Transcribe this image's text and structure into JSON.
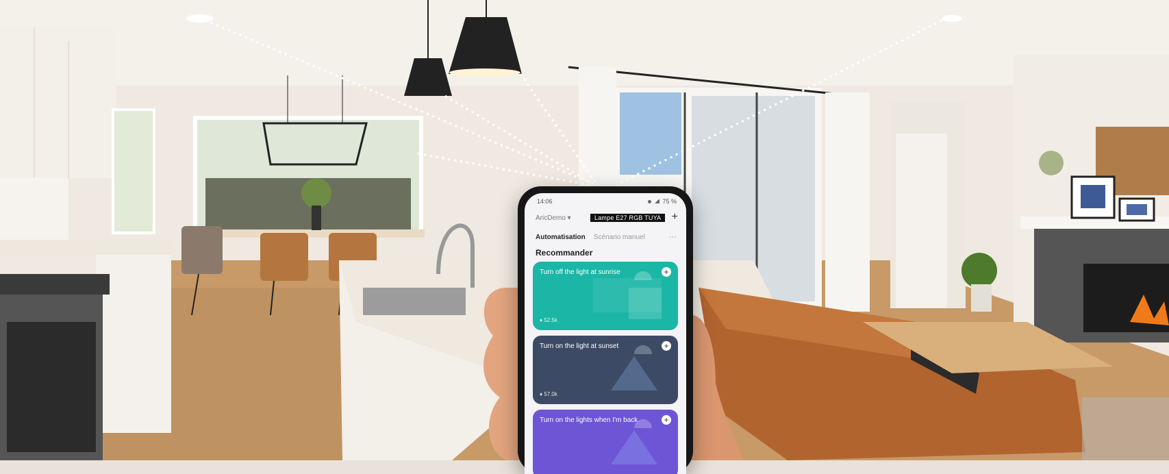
{
  "phone": {
    "status_time": "14:06",
    "status_battery": "75 %",
    "home_name": "AricDemo",
    "device_label": "Lampe E27 RGB TUYA",
    "add_symbol": "+",
    "tabs": [
      "Automatisation",
      "Scénario manuel"
    ],
    "more": "···",
    "section_title": "Recommander",
    "cards": [
      {
        "title": "Turn off the light at sunrise",
        "stat": "52.5k",
        "color": "#1bb6a6"
      },
      {
        "title": "Turn on the light at sunset",
        "stat": "57.0k",
        "color": "#3d4a66"
      },
      {
        "title": "Turn on the lights when I'm back",
        "stat": "",
        "color": "#6d55d6"
      }
    ]
  }
}
